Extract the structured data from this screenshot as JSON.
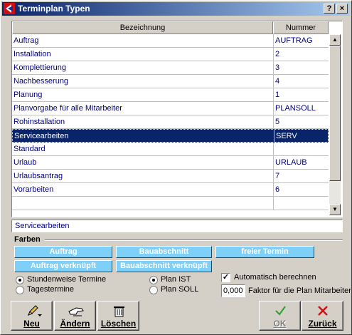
{
  "window": {
    "title": "Terminplan Typen",
    "help_label": "?",
    "close_label": "×"
  },
  "grid": {
    "columns": [
      "Bezeichnung",
      "Nummer"
    ],
    "rows": [
      {
        "name": "Auftrag",
        "number": "AUFTRAG"
      },
      {
        "name": "Installation",
        "number": "2"
      },
      {
        "name": "Komplettierung",
        "number": "3"
      },
      {
        "name": "Nachbesserung",
        "number": "4"
      },
      {
        "name": "Planung",
        "number": "1"
      },
      {
        "name": "Planvorgabe für alle Mitarbeiter",
        "number": "PLANSOLL"
      },
      {
        "name": "Rohinstallation",
        "number": "5"
      },
      {
        "name": "Servicearbeiten",
        "number": "SERV"
      },
      {
        "name": "Standard",
        "number": ""
      },
      {
        "name": "Urlaub",
        "number": "URLAUB"
      },
      {
        "name": "Urlaubsantrag",
        "number": "7"
      },
      {
        "name": "Vorarbeiten",
        "number": "6"
      },
      {
        "name": "",
        "number": ""
      }
    ],
    "selected_index": 7
  },
  "selected_value": "Servicearbeiten",
  "farben": {
    "label": "Farben",
    "buttons": {
      "auftrag": "Auftrag",
      "bauabschnitt": "Bauabschnitt",
      "freier_termin": "freier Termin",
      "auftrag_verknuepft": "Auftrag verknüpft",
      "bauabschnitt_verknuepft": "Bauabschnitt verknüpft"
    }
  },
  "options": {
    "stundenweise": "Stundenweise Termine",
    "tagestermine": "Tagestermine",
    "plan_ist": "Plan IST",
    "plan_soll": "Plan SOLL",
    "auto_berechnen": "Automatisch berechnen",
    "auto_checked": true,
    "factor_value": "0,000",
    "factor_label": "Faktor für die Plan Mitarbeiter"
  },
  "buttons": {
    "neu": "Neu",
    "aendern": "Ändern",
    "loeschen": "Löschen",
    "ok": "OK",
    "zurueck": "Zurück"
  },
  "colors": {
    "accent": "#0a246a",
    "color_button": "#7fd0f8",
    "ok_green": "#2aa12a",
    "cancel_red": "#d01010"
  }
}
